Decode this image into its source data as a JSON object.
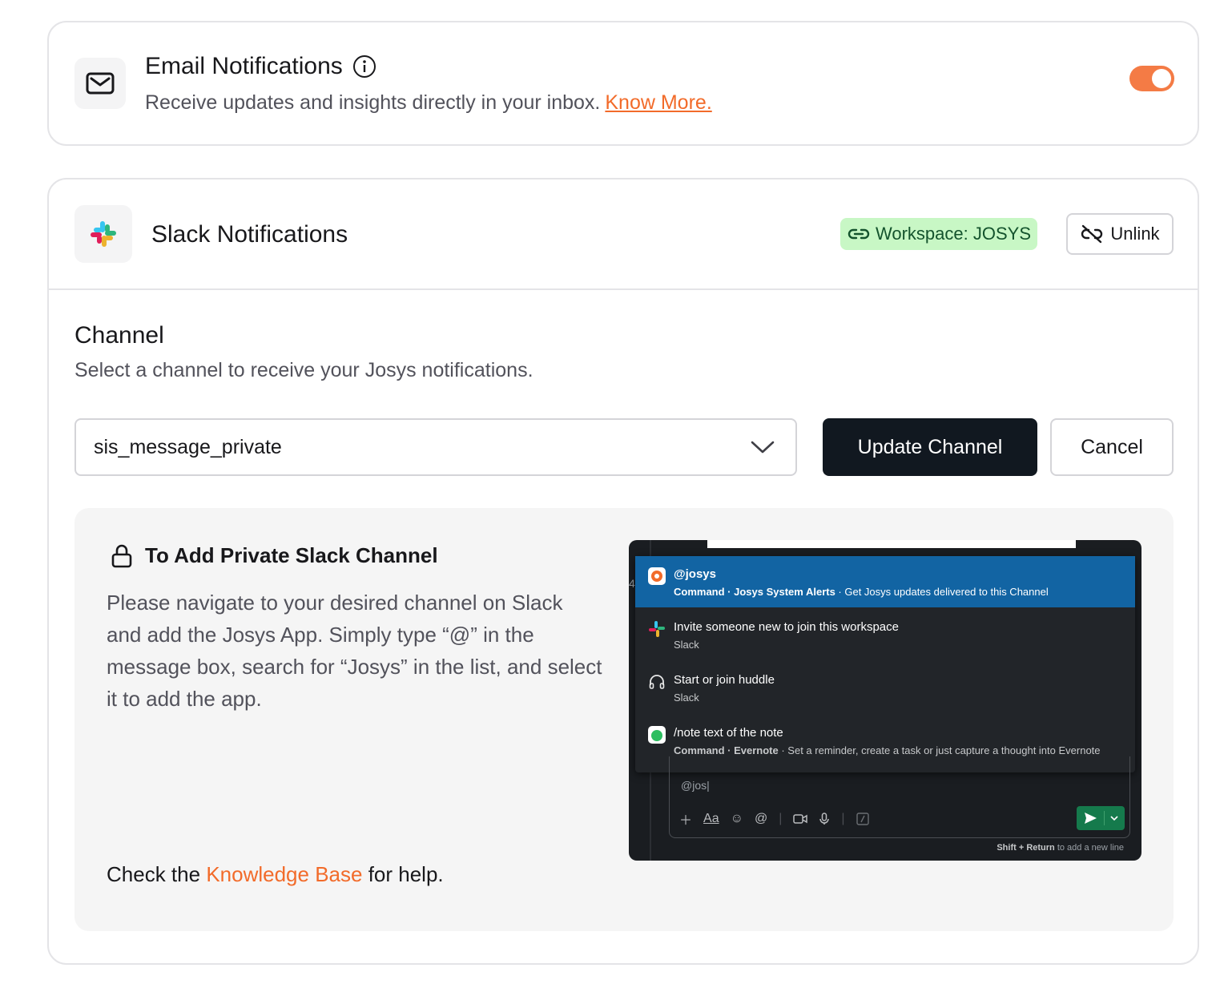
{
  "email": {
    "title": "Email Notifications",
    "description": "Receive updates and insights directly in your inbox.",
    "link": "Know More.",
    "toggle_on": true,
    "accent": "#f47b45"
  },
  "slack": {
    "title": "Slack Notifications",
    "workspace_badge": "Workspace: JOSYS",
    "unlink_label": "Unlink",
    "channel": {
      "title": "Channel",
      "description": "Select a channel to receive your Josys notifications.",
      "selected": "sis_message_private",
      "update_label": "Update Channel",
      "cancel_label": "Cancel"
    },
    "help": {
      "title": "To Add Private Slack Channel",
      "body": "Please navigate to your desired channel on Slack and add the Josys App. Simply type “@” in the message box, search for “Josys” in the list, and select it to add the app.",
      "footer_prefix": "Check the",
      "footer_link": "Knowledge Base",
      "footer_suffix": "for help."
    },
    "screenshot": {
      "line_number": "4",
      "items": [
        {
          "main": "@josys",
          "sub_bold": "Command · Josys System Alerts",
          "sub": " · Get Josys updates delivered to this Channel"
        },
        {
          "main": "Invite someone new to join this workspace",
          "sub_bold": "",
          "sub": "Slack"
        },
        {
          "main": "Start or join huddle",
          "sub_bold": "",
          "sub": "Slack"
        },
        {
          "main": "/note text of the note",
          "sub_bold": "Command · Evernote",
          "sub": " · Set a reminder, create a task or just capture a thought into Evernote"
        }
      ],
      "composer_text": "@jos|",
      "hint_bold": "Shift + Return",
      "hint": " to add a new line"
    }
  }
}
